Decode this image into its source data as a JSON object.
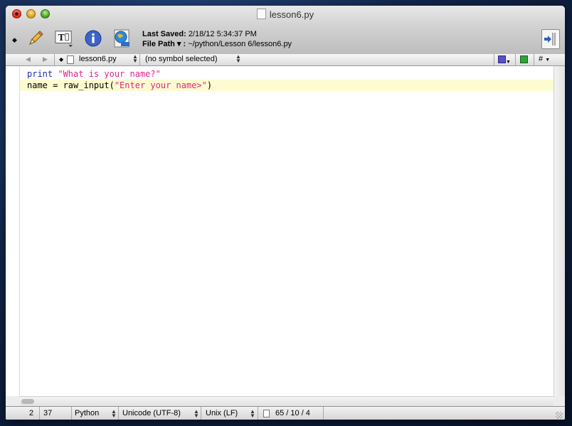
{
  "window": {
    "title": "lesson6.py"
  },
  "toolbar": {
    "last_saved_label": "Last Saved:",
    "last_saved_value": "2/18/12 5:34:37 PM",
    "file_path_label": "File Path ▾ :",
    "file_path_value": "~/python/Lesson 6/lesson6.py",
    "icons": [
      "pencil-icon",
      "text-options-icon",
      "info-icon",
      "preview-globe-icon",
      "split-view-icon"
    ]
  },
  "navbar": {
    "file_name": "lesson6.py",
    "symbol": "(no symbol selected)",
    "hash": "#"
  },
  "editor": {
    "lines": [
      {
        "parts": [
          [
            "kw",
            "print"
          ],
          [
            "plain",
            " "
          ],
          [
            "str",
            "\"What is your name?\""
          ]
        ]
      },
      {
        "parts": [
          [
            "plain",
            "name = raw_input("
          ],
          [
            "str",
            "\"Enter your name>\""
          ],
          [
            "plain",
            ")"
          ]
        ]
      }
    ],
    "current_line": 2,
    "colors": {
      "keyword": "#1d2bb2",
      "string": "#e0248a",
      "current_line_bg": "#fdfbd0"
    }
  },
  "statusbar": {
    "line": "2",
    "column": "37",
    "language": "Python",
    "encoding": "Unicode (UTF-8)",
    "line_endings": "Unix (LF)",
    "stats": "65 / 10 / 4"
  }
}
